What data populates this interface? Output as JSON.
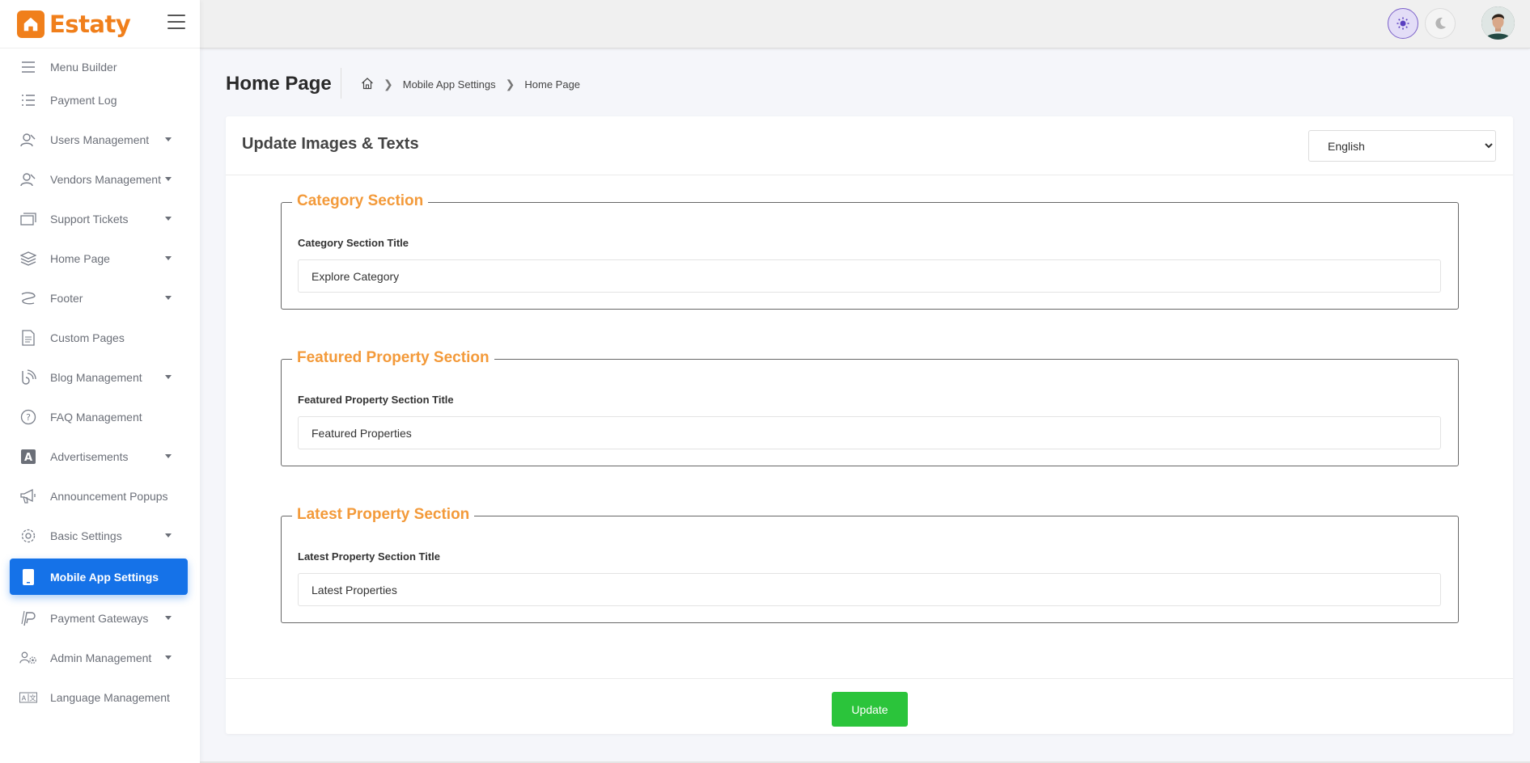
{
  "app": {
    "brand_name": "Estaty"
  },
  "sidebar": {
    "items": [
      {
        "label": "Menu Builder",
        "icon": "menu-icon",
        "caret": false
      },
      {
        "label": "Payment Log",
        "icon": "list-icon",
        "caret": false
      },
      {
        "label": "Users Management",
        "icon": "users-icon",
        "caret": true
      },
      {
        "label": "Vendors Management",
        "icon": "vendors-icon",
        "caret": true
      },
      {
        "label": "Support Tickets",
        "icon": "tickets-icon",
        "caret": true
      },
      {
        "label": "Home Page",
        "icon": "layers-icon",
        "caret": true
      },
      {
        "label": "Footer",
        "icon": "footer-icon",
        "caret": true
      },
      {
        "label": "Custom Pages",
        "icon": "page-icon",
        "caret": false
      },
      {
        "label": "Blog Management",
        "icon": "blog-icon",
        "caret": true
      },
      {
        "label": "FAQ Management",
        "icon": "question-icon",
        "caret": false
      },
      {
        "label": "Advertisements",
        "icon": "ad-icon",
        "caret": true
      },
      {
        "label": "Announcement Popups",
        "icon": "megaphone-icon",
        "caret": false
      },
      {
        "label": "Basic Settings",
        "icon": "gear-icon",
        "caret": true
      },
      {
        "label": "Mobile App Settings",
        "icon": "mobile-icon",
        "caret": false,
        "active": true
      },
      {
        "label": "Payment Gateways",
        "icon": "paypal-icon",
        "caret": true
      },
      {
        "label": "Admin Management",
        "icon": "admin-gear-icon",
        "caret": true
      },
      {
        "label": "Language Management",
        "icon": "language-icon",
        "caret": false
      }
    ]
  },
  "header": {
    "page_title": "Home Page",
    "breadcrumb": [
      "Mobile App Settings",
      "Home Page"
    ]
  },
  "card": {
    "title": "Update Images & Texts",
    "language": {
      "selected": "English"
    },
    "sections": [
      {
        "legend": "Category Section",
        "label": "Category Section Title",
        "value": "Explore Category"
      },
      {
        "legend": "Featured Property Section",
        "label": "Featured Property Section Title",
        "value": "Featured Properties"
      },
      {
        "legend": "Latest Property Section",
        "label": "Latest Property Section Title",
        "value": "Latest Properties"
      }
    ],
    "submit_label": "Update"
  },
  "colors": {
    "brand": "#f07f1b",
    "active": "#1572e8",
    "legend": "#f39a3a",
    "submit": "#2bc43b"
  }
}
